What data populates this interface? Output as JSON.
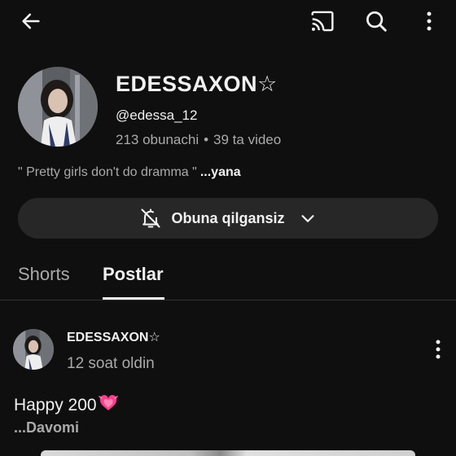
{
  "channel": {
    "name": "EDESSAXON☆",
    "handle": "@edessa_12",
    "subscribers": "213 obunachi",
    "separator": "•",
    "videos": "39 ta video",
    "bio": "\" Pretty girls don't do dramma \"",
    "bio_more": "...yana",
    "subscribe_label": "Obuna qilgansiz"
  },
  "tabs": [
    {
      "label": "Shorts",
      "selected": false
    },
    {
      "label": "Postlar",
      "selected": true
    }
  ],
  "post": {
    "author": "EDESSAXON☆",
    "time": "12 soat oldin",
    "text": "Happy 200",
    "emoji": "💓",
    "read_more": "...Davomi"
  },
  "icons": {
    "back": "arrow-back-icon",
    "cast": "cast-icon",
    "search": "search-icon",
    "more": "more-vert-icon",
    "bell": "bell-off-icon",
    "chevron": "chevron-down-icon"
  },
  "colors": {
    "background": "#0f0f0f",
    "primary_text": "#f1f1f1",
    "secondary_text": "#aaaaaa",
    "pill": "#272727",
    "heart": "#ff3d8b"
  }
}
